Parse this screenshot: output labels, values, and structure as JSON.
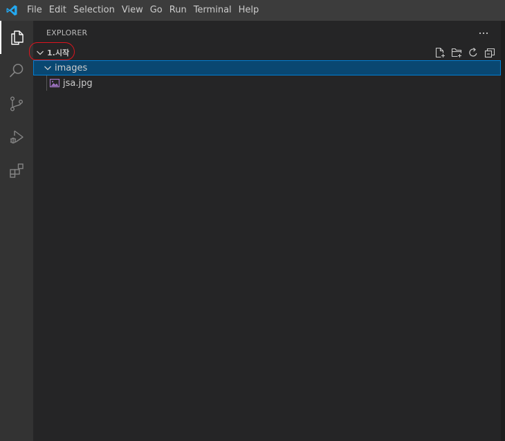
{
  "menu": {
    "items": [
      "File",
      "Edit",
      "Selection",
      "View",
      "Go",
      "Run",
      "Terminal",
      "Help"
    ]
  },
  "sidebar": {
    "title": "EXPLORER",
    "more_label": "···",
    "section": {
      "title": "1.시작",
      "actions": [
        "new-file-icon",
        "new-folder-icon",
        "refresh-icon",
        "collapse-all-icon"
      ]
    },
    "tree": [
      {
        "label": "images",
        "type": "folder",
        "expanded": true,
        "depth": 1
      },
      {
        "label": "jsa.jpg",
        "type": "image",
        "depth": 2
      }
    ]
  },
  "colors": {
    "titlebar": "#3c3c3c",
    "activitybar": "#333333",
    "sidebar": "#252526",
    "selection": "#094771",
    "focus_border": "#007fd4",
    "vscode_blue": "#23a9f2",
    "annotation": "#e0141e"
  }
}
